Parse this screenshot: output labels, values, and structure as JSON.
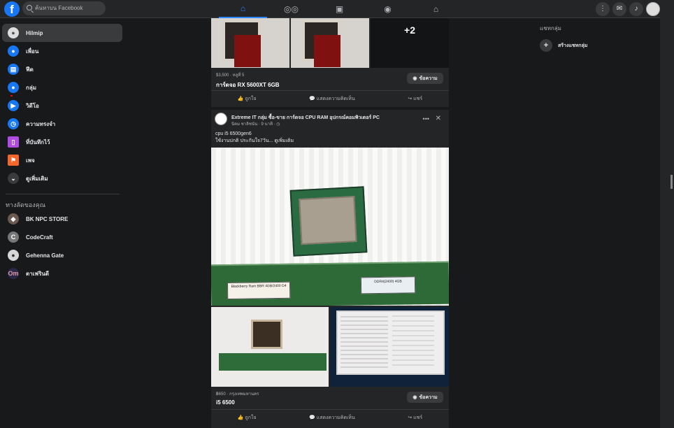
{
  "topbar": {
    "logo": "f",
    "search_placeholder": "ค้นหาบน Facebook"
  },
  "nav": [
    "home-icon",
    "friends-icon",
    "watch-icon",
    "groups-icon",
    "gaming-icon"
  ],
  "sidebar": {
    "items": [
      {
        "label": "Hilmip",
        "icon": "profile-icon"
      },
      {
        "label": "เพื่อน",
        "icon": "friends-icon"
      },
      {
        "label": "ฟีด",
        "icon": "feed-icon"
      },
      {
        "label": "กลุ่ม",
        "icon": "groups-icon"
      },
      {
        "label": "วิดีโอ",
        "icon": "video-icon"
      },
      {
        "label": "ความทรงจำ",
        "icon": "memories-icon"
      },
      {
        "label": "ที่บันทึกไว้",
        "icon": "saved-icon"
      },
      {
        "label": "เพจ",
        "icon": "pages-icon"
      },
      {
        "label": "ดูเพิ่มเติม",
        "icon": "more-icon"
      }
    ],
    "shortcuts_heading": "ทางลัดของคุณ",
    "shortcuts": [
      "BK NPC STORE",
      "CodeCraft",
      "Gehenna Gate",
      "ตาเฟรินดี"
    ]
  },
  "post1": {
    "price": "$3,500 · หลูที่ 5",
    "title": "การ์ดจอ RX 5600XT 6GB",
    "message": "ข้อความ",
    "plus": "+2"
  },
  "post_actions": [
    "ถูกใจ",
    "แสดงความคิดเห็น",
    "แชร์"
  ],
  "post2": {
    "group": "Extreme IT กลุ่ม ซื้อ-ขาย การ์ดจอ CPU RAM อุปกรณ์คอมพิวเตอร์ PC",
    "meta": "นิคม ชาลิชนัน · 9 นาที · ◷",
    "text1": "cpu i5 6500gen6",
    "text2": "ใช้งานปกติ ประกันใจ7วัน... ดูเพิ่มเติม",
    "price": "฿650 · กรุงเทพมหานคร",
    "title": "i5 6500",
    "message": "ข้อความ",
    "ram_label1": "Blackberry Ram BBR 4GB/2400 D4",
    "ram_label2": "DDR4(2400) 4GB"
  },
  "right_pane": {
    "title": "แชทกลุ่ม",
    "create": "สร้างแชทกลุ่ม"
  }
}
